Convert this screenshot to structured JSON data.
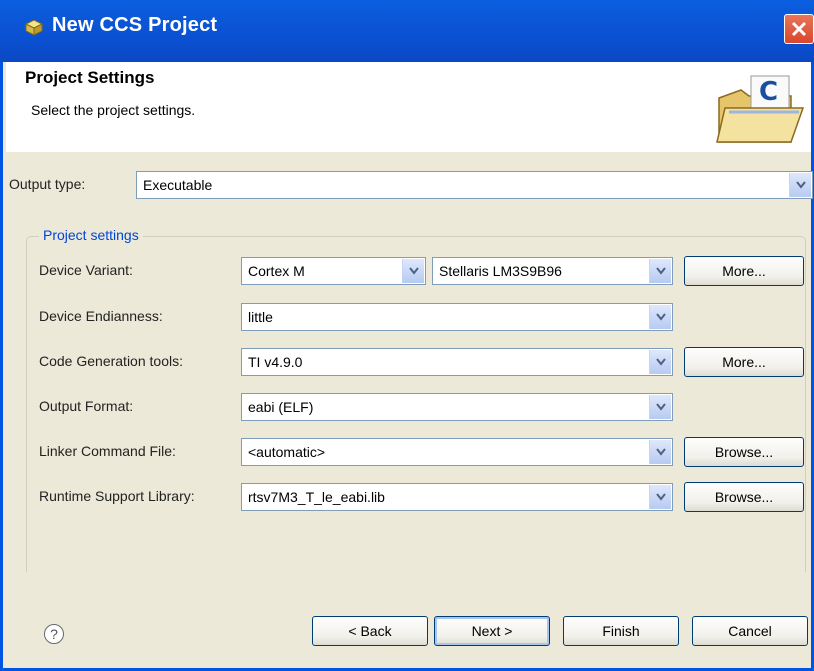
{
  "window": {
    "title": "New CCS Project",
    "icon": "ccs-project-icon"
  },
  "header": {
    "title": "Project Settings",
    "subtitle": "Select the project settings."
  },
  "output_type": {
    "label": "Output type:",
    "value": "Executable"
  },
  "project_settings": {
    "group_label": "Project settings",
    "device_variant": {
      "label": "Device Variant:",
      "family": "Cortex M",
      "device": "Stellaris LM3S9B96",
      "button": "More..."
    },
    "device_endianness": {
      "label": "Device Endianness:",
      "value": "little"
    },
    "codegen_tools": {
      "label": "Code Generation tools:",
      "value": "TI v4.9.0",
      "button": "More..."
    },
    "output_format": {
      "label": "Output Format:",
      "value": "eabi (ELF)"
    },
    "linker_command_file": {
      "label": "Linker Command File:",
      "value": "<automatic>",
      "button": "Browse..."
    },
    "runtime_support_library": {
      "label": "Runtime Support Library:",
      "value": "rtsv7M3_T_le_eabi.lib",
      "button": "Browse..."
    }
  },
  "footer": {
    "help": "?",
    "back": "< Back",
    "next": "Next >",
    "finish": "Finish",
    "cancel": "Cancel"
  },
  "colors": {
    "titlebar": "#0a4fcf",
    "group_label": "#0046d5",
    "close": "#d9472b"
  }
}
